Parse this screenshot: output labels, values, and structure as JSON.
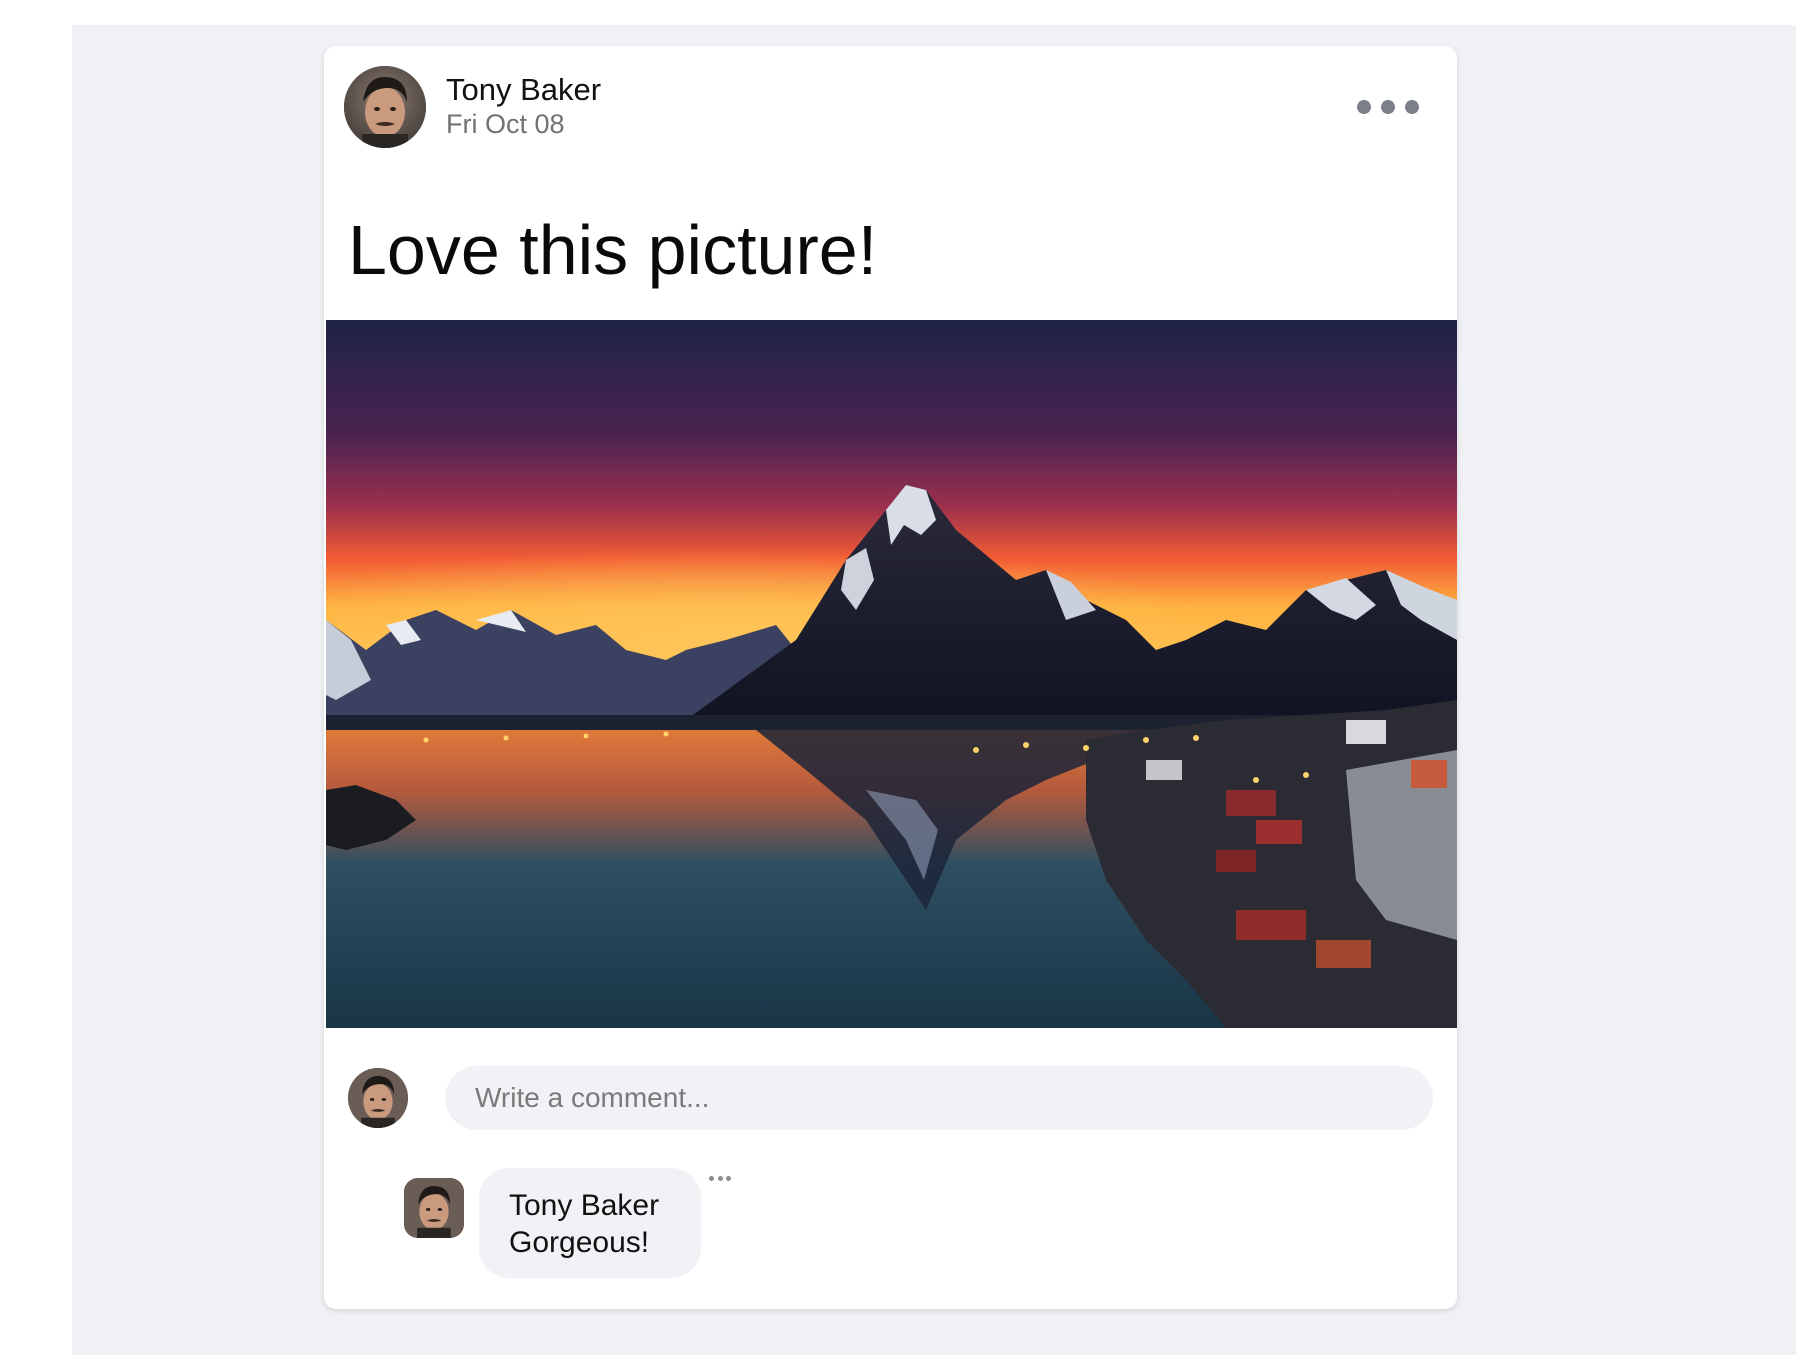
{
  "post": {
    "author": "Tony Baker",
    "date": "Fri Oct 08",
    "text": "Love this picture!",
    "more_icon": "more-horizontal-icon",
    "image_subject": "photo-mountain-lake-sunset"
  },
  "composer": {
    "placeholder": "Write a comment...",
    "value": ""
  },
  "comments": [
    {
      "author": "Tony Baker",
      "text": "Gorgeous!",
      "more_icon": "more-horizontal-icon"
    }
  ],
  "colors": {
    "page_background": "#f0f1f5",
    "card_background": "#ffffff",
    "input_background": "#f0f2f5",
    "secondary_text": "#727272"
  }
}
